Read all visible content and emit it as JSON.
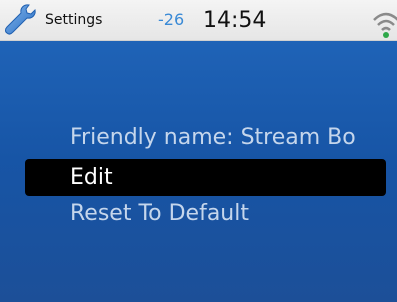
{
  "status_bar": {
    "app_title": "Settings",
    "signal_value": "-26",
    "clock": "14:54",
    "icons": [
      "wrench-icon",
      "wifi-icon"
    ],
    "accent_color": "#3a8ad6"
  },
  "menu": {
    "items": [
      {
        "label": "Friendly name: Stream Bo",
        "selected": false
      },
      {
        "label": "Edit",
        "selected": true
      },
      {
        "label": "Reset To Default",
        "selected": false
      }
    ],
    "highlight_color": "#000000",
    "background_color": "#1b5aab"
  }
}
